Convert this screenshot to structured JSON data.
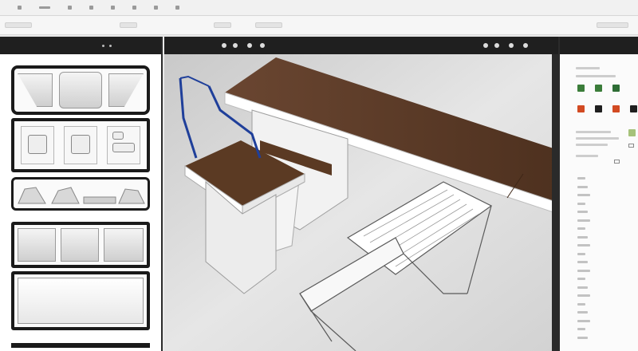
{
  "app": {
    "title": "",
    "colors": {
      "accent_dark": "#1f1f1f",
      "wood": "#5b3a23",
      "blue": "#1f3f9a"
    }
  },
  "menubar": {
    "items": [
      "",
      "",
      "",
      "",
      "",
      "",
      "",
      "",
      ""
    ]
  },
  "toolbar": {
    "chips": [
      "",
      "",
      "",
      "",
      ""
    ]
  },
  "left_panel": {
    "header_label": "",
    "icons": [
      "panel-icon",
      "grid-icon"
    ]
  },
  "viewport": {
    "header_icons": [
      "view-icon",
      "light-icon",
      "camera-icon",
      "render-icon"
    ],
    "right_icons": [
      "zoom-icon",
      "pan-icon",
      "orbit-icon",
      "settings-icon"
    ]
  },
  "right_panel": {
    "swatch_colors": [
      "#3b7d3a",
      "#3b7d3a",
      "#2e6d35",
      "#d24a22",
      "#1f1f1f",
      "#d24a22",
      "#1f1f1f",
      "#a6c27a"
    ],
    "list_items": [
      "",
      "",
      "",
      "",
      "",
      "",
      "",
      "",
      "",
      "",
      "",
      "",
      "",
      "",
      "",
      "",
      "",
      "",
      "",
      ""
    ]
  }
}
